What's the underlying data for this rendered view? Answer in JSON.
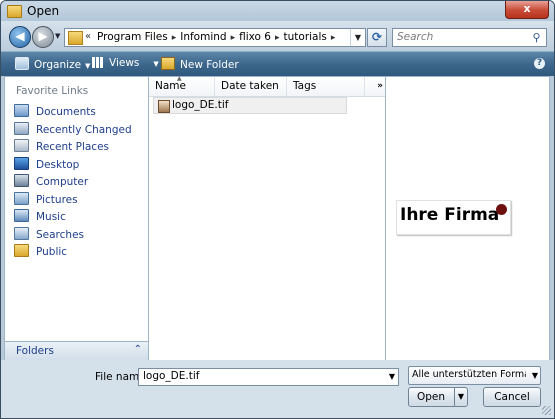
{
  "window": {
    "title": "Open",
    "close_label": "x"
  },
  "address": {
    "breadcrumbs": [
      "Program Files",
      "Infomind",
      "flixo 6",
      "tutorials"
    ],
    "search_placeholder": "Search"
  },
  "toolbar": {
    "organize": "Organize",
    "views": "Views",
    "new_folder": "New Folder"
  },
  "favorites": {
    "title": "Favorite Links",
    "items": [
      {
        "label": "Documents",
        "icon": "documents-icon"
      },
      {
        "label": "Recently Changed",
        "icon": "recently-changed-icon"
      },
      {
        "label": "Recent Places",
        "icon": "recent-places-icon"
      },
      {
        "label": "Desktop",
        "icon": "desktop-icon"
      },
      {
        "label": "Computer",
        "icon": "computer-icon"
      },
      {
        "label": "Pictures",
        "icon": "pictures-icon"
      },
      {
        "label": "Music",
        "icon": "music-icon"
      },
      {
        "label": "Searches",
        "icon": "searches-icon"
      },
      {
        "label": "Public",
        "icon": "public-icon"
      }
    ],
    "folders_label": "Folders"
  },
  "files": {
    "columns": [
      "Name",
      "Date taken",
      "Tags"
    ],
    "more": "»",
    "items": [
      {
        "name": "logo_DE.tif"
      }
    ]
  },
  "preview": {
    "logo_text": "Ihre Firma"
  },
  "footer": {
    "file_name_label": "File name:",
    "file_name_value": "logo_DE.tif",
    "file_type_value": "Alle unterstützten Formate (*.b",
    "open_label": "Open",
    "cancel_label": "Cancel"
  }
}
